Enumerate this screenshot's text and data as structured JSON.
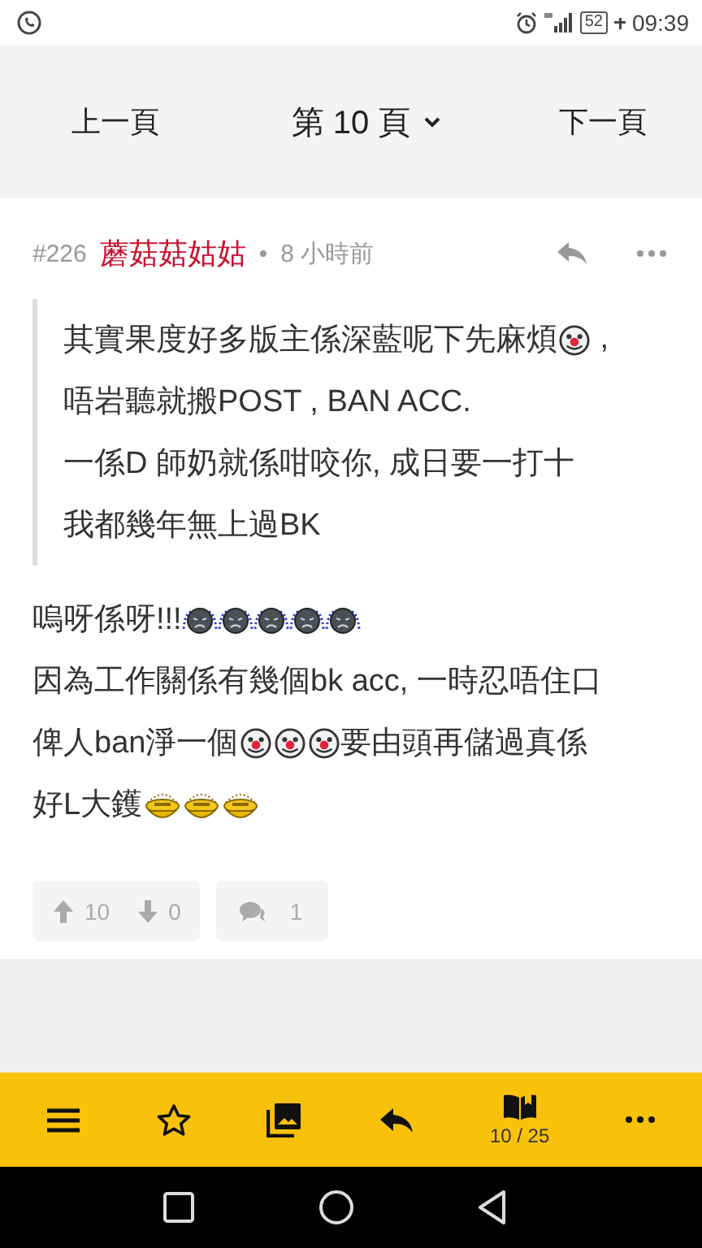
{
  "status_bar": {
    "battery": "52",
    "time": "09:39"
  },
  "page_nav": {
    "prev": "上一頁",
    "current": "第 10 頁",
    "next": "下一頁"
  },
  "post": {
    "number": "#226",
    "author": "蘑菇菇姑姑",
    "separator": "•",
    "time": "8 小時前",
    "quote": [
      {
        "segments": [
          {
            "kind": "text",
            "text": "其實果度好多版主係深藍呢下先麻煩"
          },
          {
            "kind": "clown"
          },
          {
            "kind": "text",
            "text": " ,"
          }
        ]
      },
      {
        "segments": [
          {
            "kind": "text",
            "text": "唔岩聽就搬POST , BAN ACC."
          }
        ]
      },
      {
        "segments": [
          {
            "kind": "text",
            "text": "一係D 師奶就係咁咬你, 成日要一打十"
          }
        ]
      },
      {
        "segments": [
          {
            "kind": "text",
            "text": "我都幾年無上過BK"
          }
        ]
      }
    ],
    "body": [
      {
        "segments": [
          {
            "kind": "text",
            "text": "嗚呀係呀!!!"
          },
          {
            "kind": "crying"
          },
          {
            "kind": "crying"
          },
          {
            "kind": "crying"
          },
          {
            "kind": "crying"
          },
          {
            "kind": "crying"
          }
        ]
      },
      {
        "segments": [
          {
            "kind": "text",
            "text": "因為工作關係有幾個bk acc, 一時忍唔住口"
          }
        ]
      },
      {
        "segments": [
          {
            "kind": "text",
            "text": "俾人ban淨一個"
          },
          {
            "kind": "clown"
          },
          {
            "kind": "clown"
          },
          {
            "kind": "clown"
          },
          {
            "kind": "text",
            "text": "要由頭再儲過真係"
          }
        ]
      },
      {
        "segments": [
          {
            "kind": "text",
            "text": "好L大鑊"
          },
          {
            "kind": "yellow"
          },
          {
            "kind": "yellow"
          },
          {
            "kind": "yellow"
          }
        ]
      }
    ],
    "upvotes": "10",
    "downvotes": "0",
    "replies": "1"
  },
  "toolbar": {
    "page_count": "10 / 25"
  }
}
